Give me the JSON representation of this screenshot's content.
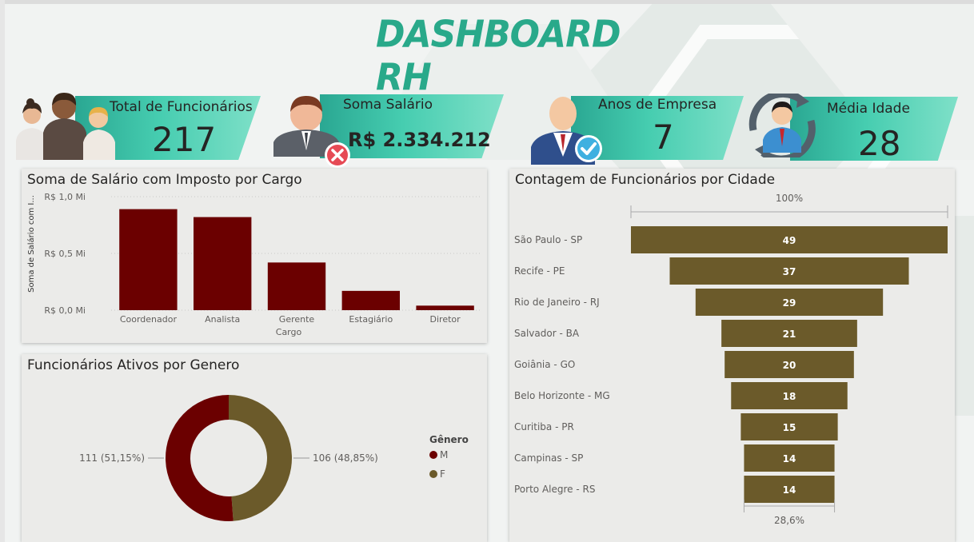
{
  "header": {
    "title": "DASHBOARD RH"
  },
  "kpis": [
    {
      "label": "Total de Funcionários",
      "value": "217",
      "icon": "people-group-icon"
    },
    {
      "label": "Soma Salário",
      "value": "R$ 2.334.212",
      "icon": "businessman-remove-icon"
    },
    {
      "label": "Anos de Empresa",
      "value": "7",
      "icon": "manager-check-icon"
    },
    {
      "label": "Média Idade",
      "value": "28",
      "icon": "person-cycle-icon"
    }
  ],
  "panels": {
    "salary": {
      "title": "Soma de Salário com Imposto por Cargo"
    },
    "gender": {
      "title": "Funcionários Ativos por Genero"
    },
    "city": {
      "title": "Contagem de Funcionários por Cidade"
    }
  },
  "colors": {
    "accent": "#29a98a",
    "bar": "#6b0000",
    "male": "#6b0000",
    "female": "#6b5a2a",
    "funnel": "#6b5a2a"
  },
  "chart_data": [
    {
      "type": "bar",
      "title": "Soma de Salário com Imposto por Cargo",
      "xlabel": "Cargo",
      "ylabel": "Soma de Salário com I...",
      "categories": [
        "Coordenador",
        "Analista",
        "Gerente",
        "Estagiário",
        "Diretor"
      ],
      "values": [
        0.89,
        0.82,
        0.42,
        0.17,
        0.04
      ],
      "yticks": [
        {
          "value": 0,
          "label": "R$ 0,0 Mi"
        },
        {
          "value": 0.5,
          "label": "R$ 0,5 Mi"
        },
        {
          "value": 1.0,
          "label": "R$ 1,0 Mi"
        }
      ],
      "ylim": [
        0,
        1.0
      ],
      "grid": true
    },
    {
      "type": "pie",
      "title": "Funcionários Ativos por Genero",
      "legend_title": "Gênero",
      "legend": "right",
      "slices": [
        {
          "name": "M",
          "value": 111,
          "label": "111 (51,15%)",
          "color": "#6b0000"
        },
        {
          "name": "F",
          "value": 106,
          "label": "106 (48,85%)",
          "color": "#6b5a2a"
        }
      ]
    },
    {
      "type": "funnel",
      "title": "Contagem de Funcionários por Cidade",
      "top_label": "100%",
      "bottom_label": "28,6%",
      "categories": [
        "São Paulo - SP",
        "Recife - PE",
        "Rio de Janeiro - RJ",
        "Salvador - BA",
        "Goiânia - GO",
        "Belo Horizonte - MG",
        "Curitiba - PR",
        "Campinas - SP",
        "Porto Alegre - RS"
      ],
      "values": [
        49,
        37,
        29,
        21,
        20,
        18,
        15,
        14,
        14
      ]
    }
  ]
}
